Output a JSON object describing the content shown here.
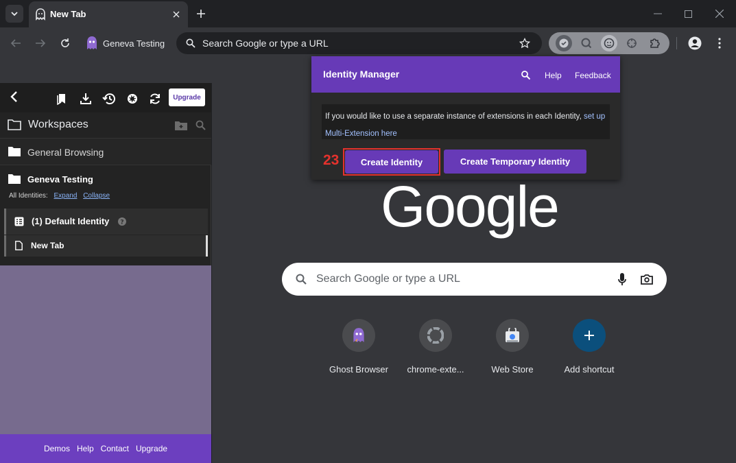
{
  "browser": {
    "tab_title": "New Tab",
    "profile_name": "Geneva Testing",
    "omnibox_placeholder": "Search Google or type a URL"
  },
  "sidebar": {
    "upgrade_label": "Upgrade",
    "workspaces_title": "Workspaces",
    "workspaces": [
      {
        "name": "General Browsing"
      },
      {
        "name": "Geneva Testing"
      }
    ],
    "all_identities_label": "All Identities:",
    "expand_label": "Expand",
    "collapse_label": "Collapse",
    "identity_label": "(1) Default Identity",
    "tab_label": "New Tab",
    "footer_links": [
      "Demos",
      "Help",
      "Contact",
      "Upgrade"
    ]
  },
  "ntp": {
    "logo_text": "Google",
    "search_placeholder": "Search Google or type a URL",
    "shortcuts": [
      {
        "label": "Ghost Browser",
        "icon": "ghost-icon"
      },
      {
        "label": "chrome-exte...",
        "icon": "chrome-extension-icon"
      },
      {
        "label": "Web Store",
        "icon": "web-store-icon"
      },
      {
        "label": "Add shortcut",
        "icon": "plus-icon"
      }
    ]
  },
  "popup": {
    "title": "Identity Manager",
    "help_label": "Help",
    "feedback_label": "Feedback",
    "info_text": "If you would like to use a separate instance of extensions in each Identity,",
    "info_link": "set up Multi-Extension here",
    "annotation_number": "23",
    "create_identity_label": "Create Identity",
    "create_temp_identity_label": "Create Temporary Identity"
  },
  "colors": {
    "accent_purple": "#673ab7",
    "highlight_red": "#e5322d",
    "sidebar_purple": "#776b8e"
  }
}
